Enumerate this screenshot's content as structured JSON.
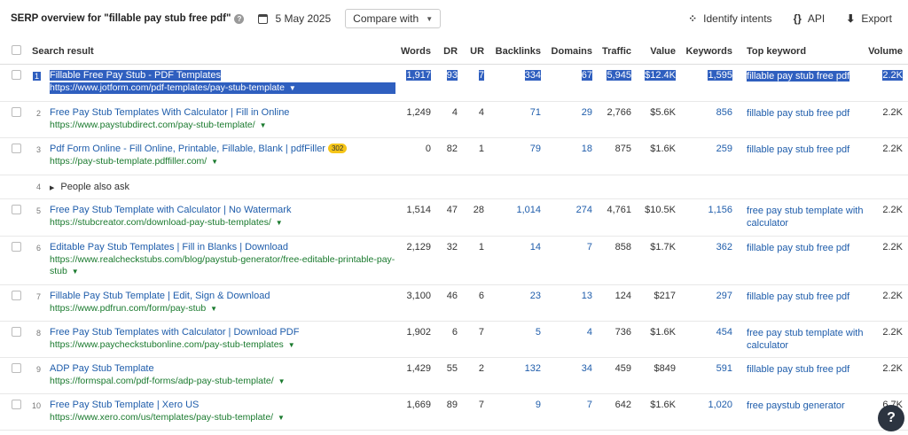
{
  "header": {
    "title": "SERP overview for \"fillable pay stub free pdf\"",
    "help_glyph": "?",
    "date": "5 May 2025",
    "compare_label": "Compare with",
    "actions": [
      {
        "icon": "sparkle-icon",
        "glyph": "⁘",
        "label": "Identify intents"
      },
      {
        "icon": "code-braces-icon",
        "glyph": "{}",
        "label": "API"
      },
      {
        "icon": "export-icon",
        "glyph": "⬇",
        "label": "Export"
      }
    ]
  },
  "columns": {
    "search_result": "Search result",
    "words": "Words",
    "dr": "DR",
    "ur": "UR",
    "backlinks": "Backlinks",
    "domains": "Domains",
    "traffic": "Traffic",
    "value": "Value",
    "keywords": "Keywords",
    "top_keyword": "Top keyword",
    "volume": "Volume"
  },
  "rows": [
    {
      "pos": "1",
      "title": "Fillable Free Pay Stub - PDF Templates",
      "url": "https://www.jotform.com/pdf-templates/pay-stub-template",
      "words": "1,917",
      "dr": "93",
      "ur": "7",
      "backlinks": "334",
      "domains": "67",
      "traffic": "5,945",
      "value": "$12.4K",
      "keywords": "1,595",
      "top_keyword": "fillable pay stub free pdf",
      "volume": "2.2K",
      "selected": true
    },
    {
      "pos": "2",
      "title": "Free Pay Stub Templates With Calculator | Fill in Online",
      "url": "https://www.paystubdirect.com/pay-stub-template/",
      "words": "1,249",
      "dr": "4",
      "ur": "4",
      "backlinks": "71",
      "domains": "29",
      "traffic": "2,766",
      "value": "$5.6K",
      "keywords": "856",
      "top_keyword": "fillable pay stub free pdf",
      "volume": "2.2K"
    },
    {
      "pos": "3",
      "title": "Pdf Form Online - Fill Online, Printable, Fillable, Blank | pdfFiller",
      "badge": "302",
      "url": "https://pay-stub-template.pdffiller.com/",
      "words": "0",
      "dr": "82",
      "ur": "1",
      "backlinks": "79",
      "domains": "18",
      "traffic": "875",
      "value": "$1.6K",
      "keywords": "259",
      "top_keyword": "fillable pay stub free pdf",
      "volume": "2.2K"
    },
    {
      "pos": "4",
      "paa": "People also ask"
    },
    {
      "pos": "5",
      "title": "Free Pay Stub Template with Calculator | No Watermark",
      "url": "https://stubcreator.com/download-pay-stub-templates/",
      "words": "1,514",
      "dr": "47",
      "ur": "28",
      "backlinks": "1,014",
      "domains": "274",
      "traffic": "4,761",
      "value": "$10.5K",
      "keywords": "1,156",
      "top_keyword": "free pay stub template with calculator",
      "volume": "2.2K"
    },
    {
      "pos": "6",
      "title": "Editable Pay Stub Templates | Fill in Blanks | Download",
      "url": "https://www.realcheckstubs.com/blog/paystub-generator/free-editable-printable-pay-stub",
      "words": "2,129",
      "dr": "32",
      "ur": "1",
      "backlinks": "14",
      "domains": "7",
      "traffic": "858",
      "value": "$1.7K",
      "keywords": "362",
      "top_keyword": "fillable pay stub free pdf",
      "volume": "2.2K"
    },
    {
      "pos": "7",
      "title": "Fillable Pay Stub Template | Edit, Sign & Download",
      "url": "https://www.pdfrun.com/form/pay-stub",
      "words": "3,100",
      "dr": "46",
      "ur": "6",
      "backlinks": "23",
      "domains": "13",
      "traffic": "124",
      "value": "$217",
      "keywords": "297",
      "top_keyword": "fillable pay stub free pdf",
      "volume": "2.2K"
    },
    {
      "pos": "8",
      "title": "Free Pay Stub Templates with Calculator | Download PDF",
      "url": "https://www.paycheckstubonline.com/pay-stub-templates",
      "words": "1,902",
      "dr": "6",
      "ur": "7",
      "backlinks": "5",
      "domains": "4",
      "traffic": "736",
      "value": "$1.6K",
      "keywords": "454",
      "top_keyword": "free pay stub template with calculator",
      "volume": "2.2K"
    },
    {
      "pos": "9",
      "title": "ADP Pay Stub Template",
      "url": "https://formspal.com/pdf-forms/adp-pay-stub-template/",
      "words": "1,429",
      "dr": "55",
      "ur": "2",
      "backlinks": "132",
      "domains": "34",
      "traffic": "459",
      "value": "$849",
      "keywords": "591",
      "top_keyword": "fillable pay stub free pdf",
      "volume": "2.2K"
    },
    {
      "pos": "10",
      "title": "Free Pay Stub Template | Xero US",
      "url": "https://www.xero.com/us/templates/pay-stub-template/",
      "words": "1,669",
      "dr": "89",
      "ur": "7",
      "backlinks": "9",
      "domains": "7",
      "traffic": "642",
      "value": "$1.6K",
      "keywords": "1,020",
      "top_keyword": "free paystub generator",
      "volume": "6.7K"
    }
  ],
  "help_fab": "?",
  "colors": {
    "link": "#1f5dab",
    "url": "#1a7a2e",
    "selection": "#2f5fbf",
    "badge": "#f5c518"
  }
}
